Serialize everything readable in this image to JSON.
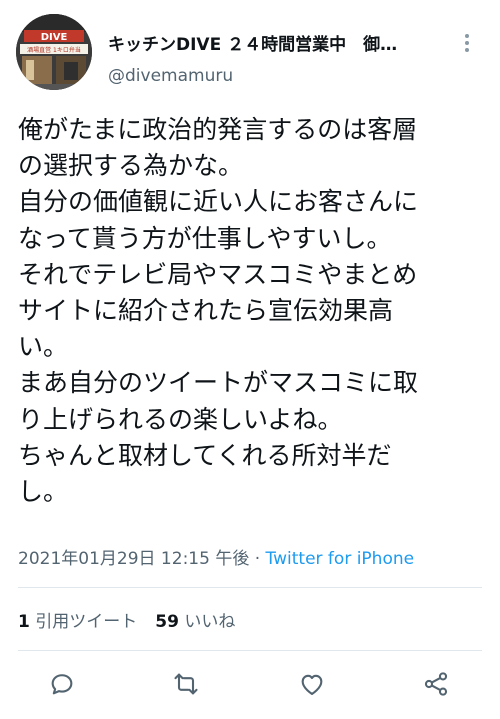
{
  "tweet": {
    "author": {
      "display_name": "キッチンDIVE ２４時間営業中　御…",
      "handle": "@divemamuru",
      "avatar_sign_text": "DIVE",
      "avatar_subtext": "酒場直営 1キロ弁当"
    },
    "text_lines": [
      "俺がたまに政治的発言するのは客層",
      "の選択する為かな。",
      "自分の価値観に近い人にお客さんに",
      "なって貰う方が仕事しやすいし。",
      "それでテレビ局やマスコミやまとめ",
      "サイトに紹介されたら宣伝効果高",
      "い。",
      "まあ自分のツイートがマスコミに取",
      "り上げられるの楽しいよね。",
      "ちゃんと取材してくれる所対半だ",
      "し。"
    ],
    "timestamp": "2021年01月29日 12:15 午後",
    "separator": " · ",
    "source": "Twitter for iPhone",
    "stats": {
      "quote_count": "1",
      "quote_label": "引用ツイート",
      "like_count": "59",
      "like_label": "いいね"
    },
    "actions": [
      {
        "icon": "reply-icon"
      },
      {
        "icon": "retweet-icon"
      },
      {
        "icon": "like-icon"
      },
      {
        "icon": "share-icon"
      }
    ]
  },
  "colors": {
    "text": "#0f1419",
    "secondary": "#536471",
    "link": "#1d9bf0",
    "divider": "#e1e8ed",
    "icon": "#536471"
  }
}
